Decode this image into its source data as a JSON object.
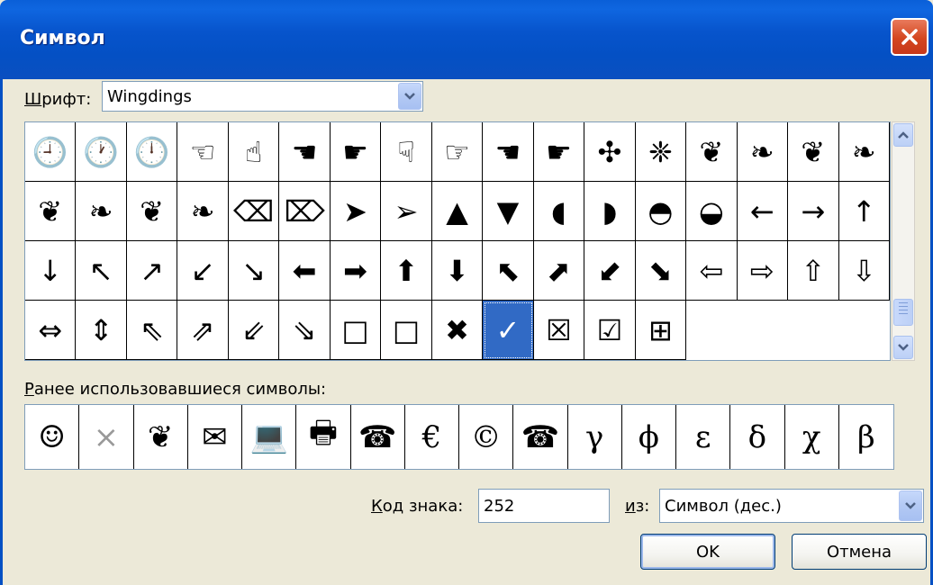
{
  "window": {
    "title": "Символ",
    "close_icon": "close-icon"
  },
  "font": {
    "label_prefix": "Ш",
    "label_rest": "рифт:",
    "value": "Wingdings"
  },
  "symbols": [
    "🕘",
    "🕐",
    "🕛",
    "☜",
    "☝",
    "☚",
    "☛",
    "☟",
    "☞",
    "☚",
    "☛",
    "✣",
    "❈",
    "❦",
    "❧",
    "❦",
    "❧",
    "❦",
    "❧",
    "❦",
    "❧",
    "⌫",
    "⌦",
    "➤",
    "➢",
    "▲",
    "▼",
    "◖",
    "◗",
    "◓",
    "◒",
    "←",
    "→",
    "↑",
    "↓",
    "↖",
    "↗",
    "↙",
    "↘",
    "⬅",
    "➡",
    "⬆",
    "⬇",
    "⬉",
    "⬈",
    "⬋",
    "⬊",
    "⇦",
    "⇨",
    "⇧",
    "⇩",
    "⇔",
    "⇕",
    "⇖",
    "⇗",
    "⇙",
    "⇘",
    "□",
    "□",
    "✖",
    "✓",
    "☒",
    "☑",
    "⊞"
  ],
  "selected_index": 60,
  "recent": {
    "label_prefix": "Р",
    "label_rest": "анее использовавшиеся символы:",
    "items": [
      "☺",
      "×",
      "❦",
      "✉",
      "💻",
      "🖶",
      "☎",
      "€",
      "©",
      "☎",
      "γ",
      "ϕ",
      "ε",
      "δ",
      "χ",
      "β"
    ]
  },
  "code": {
    "label_prefix": "К",
    "label_rest": "од знака:",
    "value": "252"
  },
  "from": {
    "label_prefix": "и",
    "label_rest": "з:",
    "value": "Символ (дес.)"
  },
  "buttons": {
    "ok": "OK",
    "cancel": "Отмена"
  },
  "colors": {
    "title_blue": "#0450c4",
    "selection": "#316ac5",
    "dialog_bg": "#ece9d8",
    "close_red": "#d4461f"
  }
}
